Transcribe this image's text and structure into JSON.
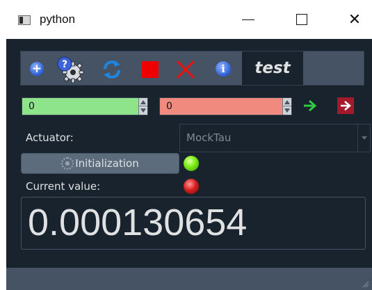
{
  "window": {
    "title": "python",
    "controls": {
      "minimize": "minimize-icon",
      "maximize": "maximize-icon",
      "close": "close-icon"
    }
  },
  "toolbar": {
    "icons": [
      "add-icon",
      "gear-help-icon",
      "refresh-icon",
      "stop-icon",
      "cross-icon",
      "info-icon"
    ],
    "tab_label": "test"
  },
  "setpoints": {
    "green_value": "0",
    "red_value": "0",
    "green_color": "#8ee48a",
    "red_color": "#f08a7e"
  },
  "form": {
    "actuator_label": "Actuator:",
    "actuator_value": "MockTau",
    "init_button_label": "Initialization",
    "current_value_label": "Current value:",
    "current_value": "0.000130654"
  },
  "status": {
    "init_led_color": "#7ff01a",
    "value_led_color": "#d82020"
  },
  "theme": {
    "background": "#19232d",
    "panel": "#455364",
    "text": "#e0e1e3"
  }
}
